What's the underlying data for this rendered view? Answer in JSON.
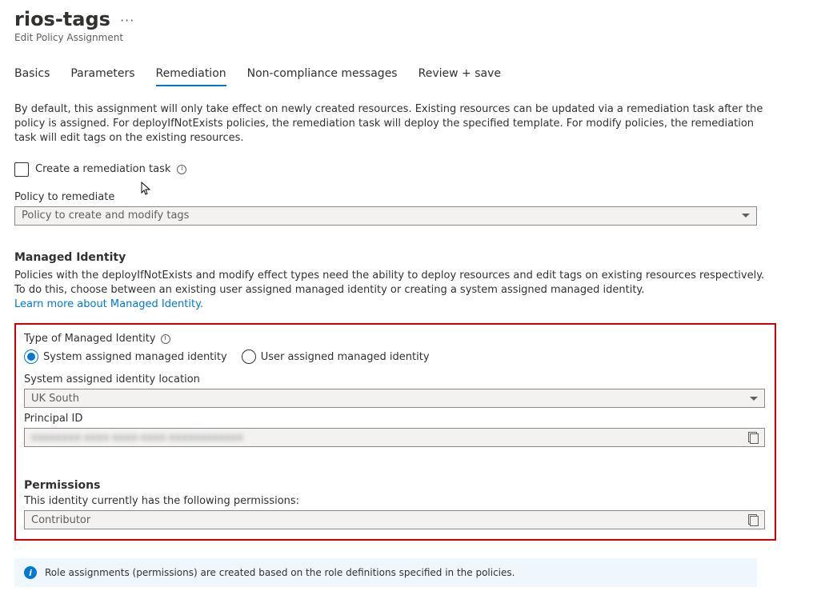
{
  "header": {
    "title": "rios-tags",
    "ellipsis": "···",
    "subtitle": "Edit Policy Assignment"
  },
  "tabs": {
    "basics": "Basics",
    "parameters": "Parameters",
    "remediation": "Remediation",
    "noncompliance": "Non-compliance messages",
    "review": "Review + save"
  },
  "remediation": {
    "description": "By default, this assignment will only take effect on newly created resources. Existing resources can be updated via a remediation task after the policy is assigned. For deployIfNotExists policies, the remediation task will deploy the specified template. For modify policies, the remediation task will edit tags on the existing resources.",
    "create_task_label": "Create a remediation task",
    "policy_to_remediate_label": "Policy to remediate",
    "policy_to_remediate_value": "Policy to create and modify tags"
  },
  "managed_identity": {
    "heading": "Managed Identity",
    "description": "Policies with the deployIfNotExists and modify effect types need the ability to deploy resources and edit tags on existing resources respectively. To do this, choose between an existing user assigned managed identity or creating a system assigned managed identity.",
    "learn_more": "Learn more about Managed Identity.",
    "type_label": "Type of Managed Identity",
    "radio_system": "System assigned managed identity",
    "radio_user": "User assigned managed identity",
    "location_label": "System assigned identity location",
    "location_value": "UK South",
    "principal_id_label": "Principal ID",
    "principal_id_value": "xxxxxxxx-xxxx-xxxx-xxxx-xxxxxxxxxxxx"
  },
  "permissions": {
    "heading": "Permissions",
    "description": "This identity currently has the following permissions:",
    "value": "Contributor"
  },
  "banner": {
    "text": "Role assignments (permissions) are created based on the role definitions specified in the policies."
  }
}
